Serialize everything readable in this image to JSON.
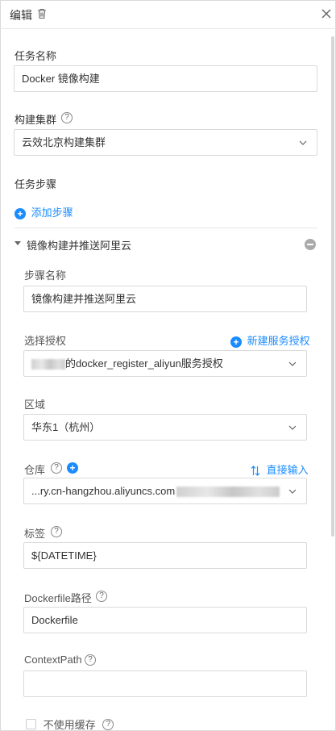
{
  "header": {
    "title": "编辑"
  },
  "task_name": {
    "label": "任务名称",
    "value": "Docker 镜像构建"
  },
  "cluster": {
    "label": "构建集群",
    "value": "云效北京构建集群"
  },
  "steps": {
    "label": "任务步骤",
    "add_label": "添加步骤",
    "step": {
      "title": "镜像构建并推送阿里云",
      "name_label": "步骤名称",
      "name_value": "镜像构建并推送阿里云",
      "auth_label": "选择授权",
      "auth_new": "新建服务授权",
      "auth_value_suffix": "的docker_register_aliyun服务授权",
      "region_label": "区域",
      "region_value": "华东1（杭州）",
      "repo_label": "仓库",
      "repo_direct": "直接输入",
      "repo_value_prefix": "...ry.cn-hangzhou.aliyuncs.com",
      "tag_label": "标签",
      "tag_value": "${DATETIME}",
      "dockerfile_label": "Dockerfile路径",
      "dockerfile_value": "Dockerfile",
      "context_label": "ContextPath",
      "context_value": "",
      "nocache_label": "不使用缓存"
    }
  },
  "colors": {
    "accent": "#1a8cff",
    "border": "#d9d9d9",
    "text": "#333333"
  },
  "icons": [
    "trash-icon",
    "close-icon",
    "help-icon",
    "chevron-down-icon",
    "plus-circle-icon",
    "collapse-caret-icon",
    "minus-circle-icon",
    "sort-arrows-icon"
  ]
}
